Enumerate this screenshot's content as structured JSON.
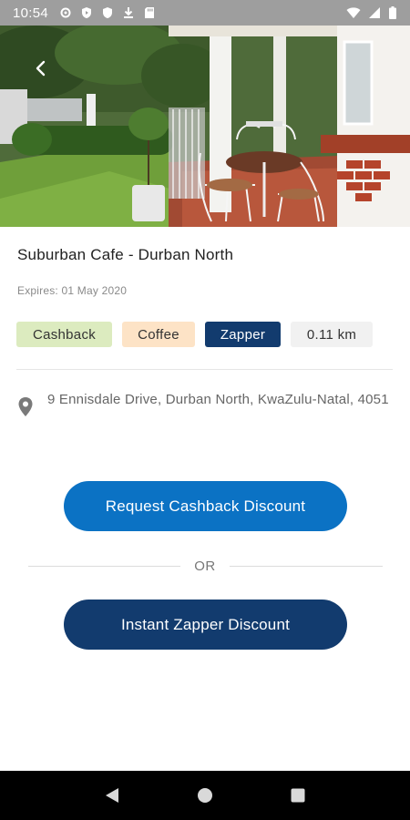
{
  "status_bar": {
    "time": "10:54",
    "left_icons": [
      "settings-icon",
      "play-protect-icon",
      "shield-icon",
      "download-icon",
      "sd-card-icon"
    ],
    "right_icons": [
      "wifi-icon",
      "cell-signal-icon",
      "battery-icon"
    ]
  },
  "hero": {
    "image_alt": "Suburban Cafe patio",
    "back_icon": "chevron-left-icon"
  },
  "listing": {
    "title": "Suburban Cafe - Durban North",
    "expires": "Expires: 01 May 2020",
    "tags": [
      "Cashback",
      "Coffee",
      "Zapper"
    ],
    "distance": "0.11 km",
    "address": "9 Ennisdale Drive, Durban North, KwaZulu-Natal, 4051"
  },
  "actions": {
    "request_cashback_label": "Request Cashback Discount",
    "or_label": "OR",
    "instant_zapper_label": "Instant Zapper Discount"
  },
  "colors": {
    "cashback_tag": "#dcebbf",
    "coffee_tag": "#fde3c6",
    "zapper_navy": "#123b6e",
    "cashback_blue": "#0b72c4"
  },
  "nav_bar": {
    "icons": [
      "back-triangle-icon",
      "home-circle-icon",
      "recents-square-icon"
    ]
  }
}
